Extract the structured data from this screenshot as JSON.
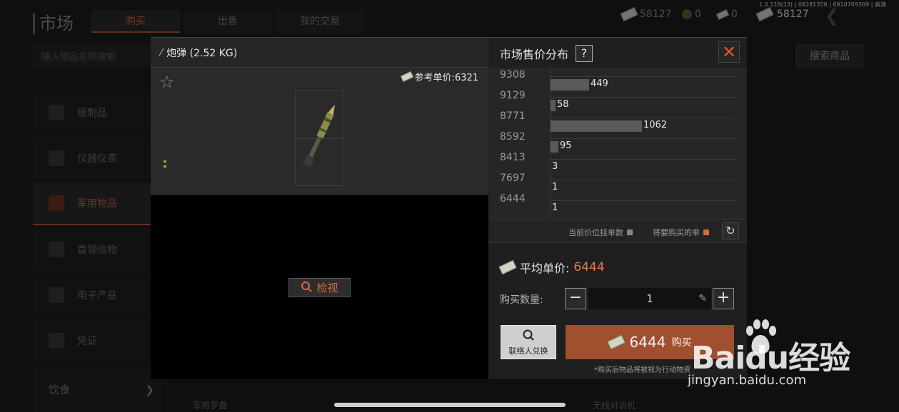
{
  "app": {
    "title": "市场",
    "tabs": [
      {
        "label": "购买",
        "active": true
      },
      {
        "label": "出售",
        "active": false
      },
      {
        "label": "我的交易",
        "active": false
      }
    ],
    "version": "1.0.118(13) | 08281358 | 6910769309 | 高清",
    "currencies": {
      "cash": "58127",
      "coin": "0",
      "notes": "0",
      "main_cash": "58127"
    },
    "search_placeholder": "输入物品名称搜索",
    "search_button": "搜索商品",
    "sidebar": [
      {
        "label": "纸制品",
        "icon": "paper-icon"
      },
      {
        "label": "仪器仪表",
        "icon": "instrument-icon"
      },
      {
        "label": "军用物品",
        "icon": "military-icon",
        "active": true
      },
      {
        "label": "首领信物",
        "icon": "boss-token-icon"
      },
      {
        "label": "电子产品",
        "icon": "electronics-icon"
      },
      {
        "label": "凭证",
        "icon": "voucher-icon"
      }
    ],
    "sidebar_food": "饮食",
    "bottom_labels": [
      "军用罗盘",
      "无线对讲机"
    ]
  },
  "modal": {
    "item_name": "炮弹 (2.52 KG)",
    "ref_price_label": "参考单价:6321",
    "inspect_label": "检视",
    "chart_title": "市场售价分布",
    "help_label": "?",
    "close_label": "✕",
    "legend_current": "当前价位挂单数",
    "legend_buy": "将要购买的单",
    "avg_label": "平均单价:",
    "avg_value": "6444",
    "qty_label": "购买数量:",
    "qty_value": "1",
    "exchange_label": "联络人兑换",
    "buy_price": "6444",
    "buy_label": "购买",
    "note": "*购买后物品将被视为行动物资",
    "colors": {
      "accent": "#de7a44",
      "buy_button": "#a0502e",
      "bar": "#5a5a5a",
      "legend_buy": "#e06a36"
    }
  },
  "chart_data": {
    "type": "bar",
    "orientation": "horizontal",
    "title": "市场售价分布",
    "categories": [
      "9308",
      "9129",
      "8771",
      "8592",
      "8413",
      "7697",
      "6444"
    ],
    "values": [
      449,
      58,
      1062,
      95,
      3,
      1,
      1
    ],
    "legend": [
      "当前价位挂单数",
      "将要购买的单"
    ],
    "grid": true
  },
  "watermark": {
    "logo": "Baidu经验",
    "url": "jingyan.baidu.com"
  }
}
